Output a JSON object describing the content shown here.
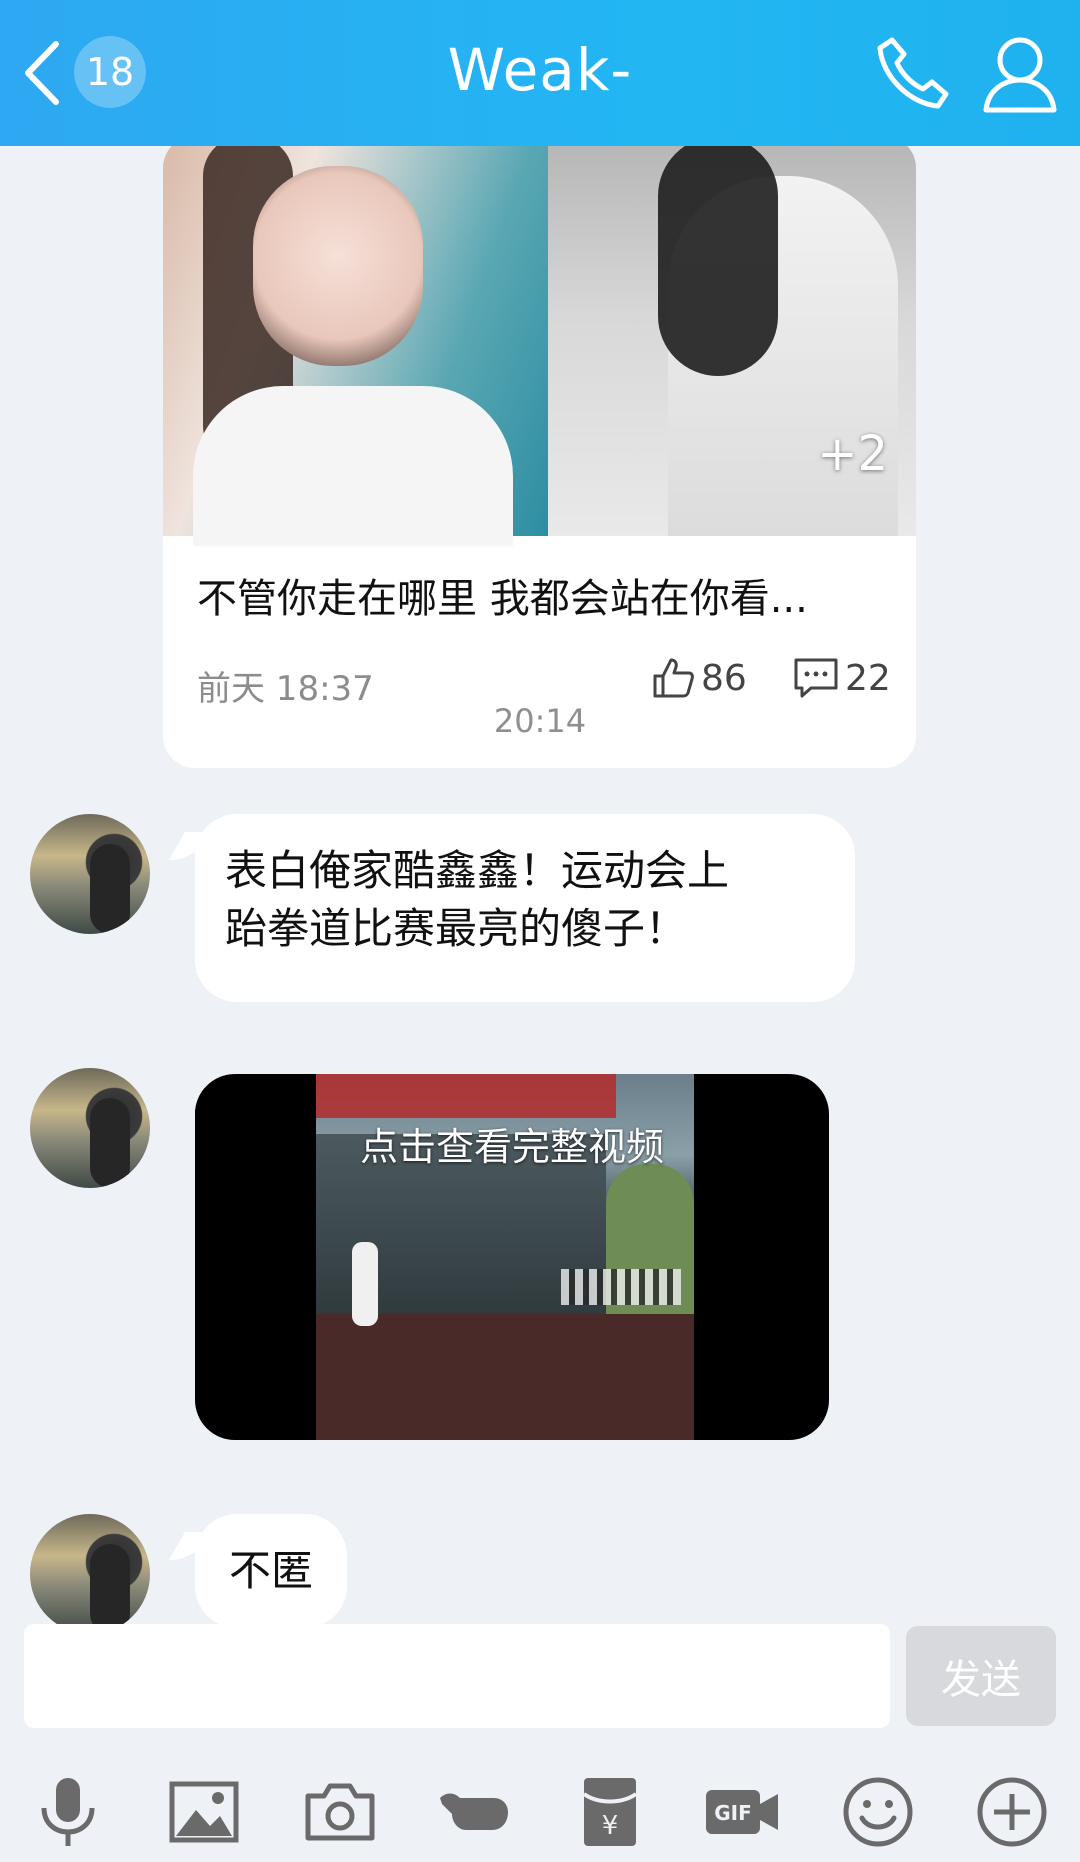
{
  "header": {
    "unread_count": "18",
    "title": "Weak-",
    "back_icon": "chevron-left-icon",
    "phone_icon": "phone-icon",
    "profile_icon": "person-icon"
  },
  "shared_post": {
    "more_images": "+2",
    "text": "不管你走在哪里 我都会站在你看...",
    "time": "前天 18:37",
    "likes": "86",
    "comments": "22"
  },
  "timestamp": "20:14",
  "messages": [
    {
      "type": "text",
      "text": "表白俺家酷鑫鑫！运动会上\n跆拳道比赛最亮的傻子！"
    },
    {
      "type": "video",
      "caption": "点击查看完整视频"
    },
    {
      "type": "text",
      "text": "不匿"
    }
  ],
  "input": {
    "value": "",
    "send_label": "发送"
  },
  "toolbar": [
    "microphone-icon",
    "image-icon",
    "camera-icon",
    "poke-icon",
    "red-packet-icon",
    "gif-icon",
    "emoji-icon",
    "plus-icon"
  ],
  "colors": {
    "header_blue": "#2ea8f2",
    "background": "#eef1f6",
    "icon_gray": "#6a6a6a"
  }
}
